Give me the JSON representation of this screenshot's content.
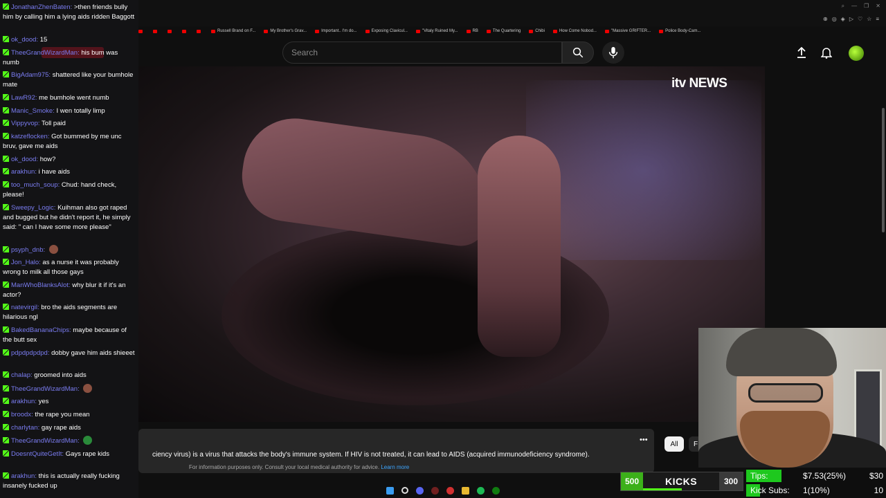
{
  "browser": {
    "bookmarks": [
      "",
      "",
      "",
      "",
      "",
      "Russell Brand on F...",
      "My Brother's Grav...",
      "Important.. I'm do...",
      "Exposing Clavicul...",
      "\"Vitaly Ruined My...",
      "RB",
      "The Quartering",
      "Chibi",
      "How Come Nobod...",
      "\"Massive GRIFTER...",
      "Police Body-Cam..."
    ]
  },
  "youtube": {
    "search_placeholder": "Search",
    "channel_logo": "itv NEWS",
    "info_text": "ciency virus) is a virus that attacks the body's immune system. If HIV is not treated, it can lead to AIDS (acquired immunodeficiency syndrome).",
    "info_sub": "For information purposes only. Consult your local medical authority for advice.",
    "info_link": "Learn more",
    "more_label": "•••",
    "chips": [
      "All",
      "F"
    ]
  },
  "chat": [
    {
      "user": "JonathanZhenBaten",
      "text": ">then friends bully him by calling him a lying aids ridden Baggott"
    },
    {
      "user": "ok_dood",
      "text": "15"
    },
    {
      "user": "TheeGrandWizardMan",
      "text": "his bum was numb"
    },
    {
      "user": "BigAdam975",
      "text": "shattered like your bumhole mate"
    },
    {
      "user": "LawR92",
      "text": "me bumhole went numb"
    },
    {
      "user": "Manic_Smoke",
      "text": "I wen totally limp"
    },
    {
      "user": "Vippyvop",
      "text": "Toll paid"
    },
    {
      "user": "katzeflocken",
      "text": "Got bummed by me unc bruv, gave me aids"
    },
    {
      "user": "ok_dood",
      "text": "how?"
    },
    {
      "user": "arakhun",
      "text": "i have aids"
    },
    {
      "user": "too_much_soup",
      "text": "Chud: hand check, please!"
    },
    {
      "user": "Sweepy_Logic",
      "text": "Kuihman also got raped and bugged but he didn't report it, he simply said: \" can I have some more please\""
    },
    {
      "user": "psyph_dnb",
      "text": ""
    },
    {
      "user": "Jon_Halo",
      "text": "as a nurse it was probably wrong to milk all those gays"
    },
    {
      "user": "ManWhoBlanksAlot",
      "text": "why blur it if it's an actor?"
    },
    {
      "user": "natevirgil",
      "text": "bro the aids segments are hilarious ngl"
    },
    {
      "user": "BakedBananaChips",
      "text": "maybe because of the butt sex"
    },
    {
      "user": "pdpdpdpdpd",
      "text": "dobby gave him aids shieeet"
    },
    {
      "user": "chalap",
      "text": "groomed into aids"
    },
    {
      "user": "TheeGrandWizardMan",
      "text": ""
    },
    {
      "user": "arakhun",
      "text": "yes"
    },
    {
      "user": "broodx",
      "text": "the rape you mean"
    },
    {
      "user": "charlytan",
      "text": "gay rape aids"
    },
    {
      "user": "TheeGrandWizardMan",
      "text": ""
    },
    {
      "user": "DoesntQuiteGetIt",
      "text": "Gays rape kids"
    },
    {
      "user": "arakhun",
      "text": "this is actually really fucking insanely fucked up"
    }
  ],
  "kicks": {
    "left": "500",
    "label": "KICKS",
    "right": "300",
    "progress": 0.62
  },
  "tips": {
    "tips_label": "Tips:",
    "tips_value": "$7.53(25%)",
    "tips_goal": "$30",
    "tips_fraction": 0.25,
    "subs_label": "Kick Subs:",
    "subs_value": "1(10%)",
    "subs_goal": "10",
    "subs_fraction": 0.1
  },
  "colors": {
    "kick_green": "#53fc18",
    "chat_user": "#7a7cf0",
    "link_blue": "#3ea6ff"
  }
}
